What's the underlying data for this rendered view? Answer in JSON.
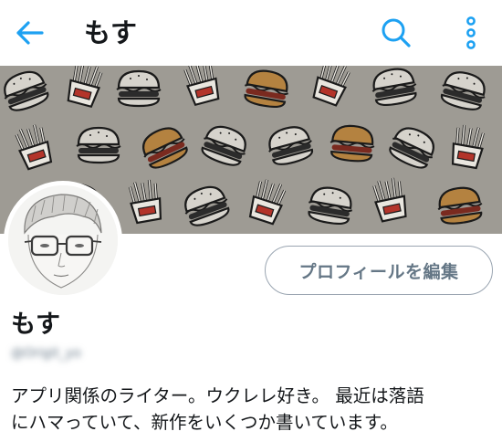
{
  "colors": {
    "accent": "#1da1f2",
    "text_primary": "#14171a",
    "text_secondary": "#657786",
    "button_border": "#9aa5b1"
  },
  "header": {
    "back_icon": "arrow-left-icon",
    "title": "もす",
    "search_icon": "search-icon",
    "more_icon": "more-vertical-icon"
  },
  "profile": {
    "banner_image": "hamburger-and-fries-pattern",
    "avatar_image": "sketch-portrait-with-glasses",
    "edit_button_label": "プロフィールを編集",
    "display_name": "もす",
    "handle": "@Origit_yo",
    "bio_line1": "アプリ関係のライター。ウクレレ好き。 最近は落語",
    "bio_line2": "にハマっていて、新作をいくつか書いています。"
  }
}
